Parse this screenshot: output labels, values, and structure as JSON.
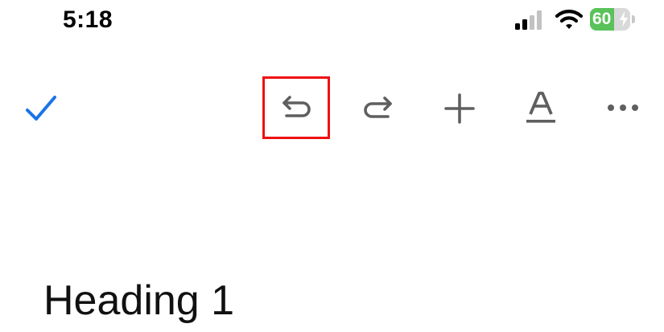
{
  "status_bar": {
    "time": "5:18",
    "battery_level": "60",
    "battery_charging": true,
    "battery_color": "#5ac25a",
    "signal_bars_active": 2,
    "signal_bars_total": 4
  },
  "toolbar": {
    "icons": {
      "done": "checkmark-icon",
      "undo": "undo-icon",
      "redo": "redo-icon",
      "insert": "plus-icon",
      "format": "text-format-icon",
      "more": "more-horizontal-icon"
    },
    "highlighted": "undo",
    "highlight_color": "#ee1111",
    "accent_color": "#1a73e8",
    "icon_color": "#5f5f5f"
  },
  "document": {
    "heading": "Heading 1"
  }
}
